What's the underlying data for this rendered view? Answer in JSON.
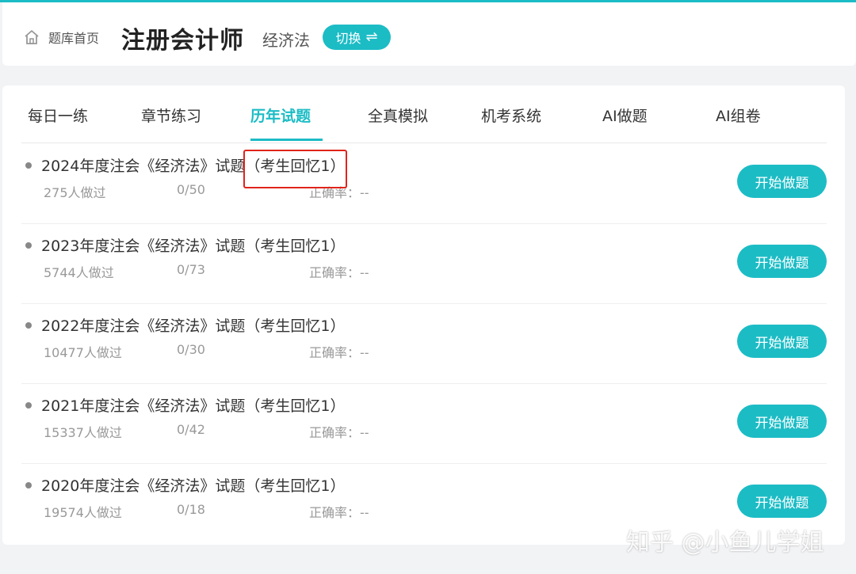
{
  "header": {
    "home_label": "题库首页",
    "home_icon": "home-icon",
    "subject_title": "注册会计师",
    "subject_name": "经济法",
    "switch_label": "切换",
    "switch_icon": "swap-icon",
    "accent_color": "#1cbcc5"
  },
  "tabs": [
    {
      "label": "每日一练",
      "active": false
    },
    {
      "label": "章节练习",
      "active": false
    },
    {
      "label": "历年试题",
      "active": true
    },
    {
      "label": "全真模拟",
      "active": false
    },
    {
      "label": "机考系统",
      "active": false
    },
    {
      "label": "AI做题",
      "active": false
    },
    {
      "label": "AI组卷",
      "active": false
    }
  ],
  "exams": [
    {
      "title": "2024年度注会《经济法》试题（考生回忆1）",
      "count": "275人做过",
      "progress": "0/50",
      "accuracy": "正确率：--",
      "button": "开始做题"
    },
    {
      "title": "2023年度注会《经济法》试题（考生回忆1）",
      "count": "5744人做过",
      "progress": "0/73",
      "accuracy": "正确率：--",
      "button": "开始做题"
    },
    {
      "title": "2022年度注会《经济法》试题（考生回忆1）",
      "count": "10477人做过",
      "progress": "0/30",
      "accuracy": "正确率：--",
      "button": "开始做题"
    },
    {
      "title": "2021年度注会《经济法》试题（考生回忆1）",
      "count": "15337人做过",
      "progress": "0/42",
      "accuracy": "正确率：--",
      "button": "开始做题"
    },
    {
      "title": "2020年度注会《经济法》试题（考生回忆1）",
      "count": "19574人做过",
      "progress": "0/18",
      "accuracy": "正确率：--",
      "button": "开始做题"
    }
  ],
  "watermark": "知乎 @小鱼儿学姐",
  "highlight_color": "#e0241b"
}
